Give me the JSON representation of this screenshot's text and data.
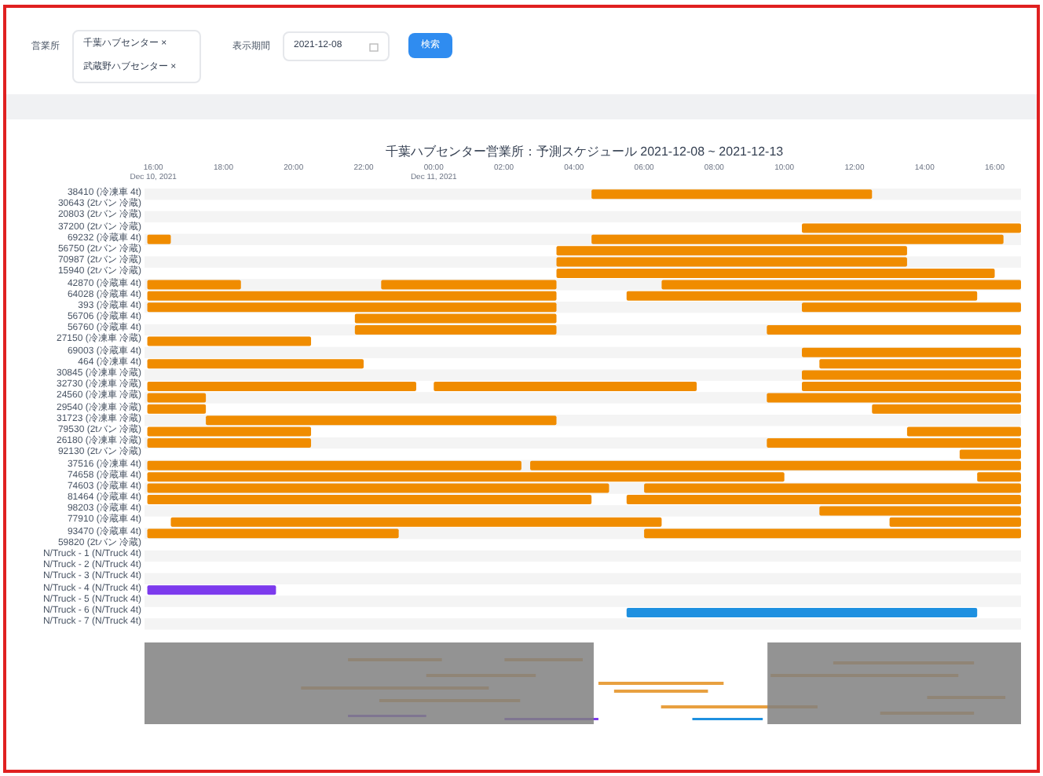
{
  "filters": {
    "office_label": "営業所",
    "offices": [
      {
        "label": "千葉ハブセンター ×"
      },
      {
        "label": "武蔵野ハブセンター ×"
      }
    ],
    "period_label": "表示期間",
    "date": "2021-12-08",
    "search_button": "検索"
  },
  "chart": {
    "title": "千葉ハブセンター営業所：予測スケジュール 2021-12-08 ~ 2021-12-13",
    "ticks": [
      {
        "label": "16:00",
        "date": "Dec 10, 2021"
      },
      {
        "label": "18:00"
      },
      {
        "label": "20:00"
      },
      {
        "label": "22:00"
      },
      {
        "label": "00:00",
        "date": "Dec 11, 2021"
      },
      {
        "label": "02:00"
      },
      {
        "label": "04:00"
      },
      {
        "label": "06:00"
      },
      {
        "label": "08:00"
      },
      {
        "label": "10:00"
      },
      {
        "label": "12:00"
      },
      {
        "label": "14:00"
      },
      {
        "label": "16:00"
      }
    ],
    "rows": [
      {
        "label": "38410 (冷凍車 4t)"
      },
      {
        "label": "30643 (2tバン 冷蔵)"
      },
      {
        "label": "20803 (2tバン 冷蔵)"
      },
      {
        "label": "37200 (2tバン 冷蔵)"
      },
      {
        "label": "69232 (冷蔵車 4t)"
      },
      {
        "label": "56750 (2tバン 冷蔵)"
      },
      {
        "label": "70987 (2tバン 冷蔵)"
      },
      {
        "label": "15940 (2tバン 冷蔵)"
      },
      {
        "label": "42870 (冷蔵車 4t)"
      },
      {
        "label": "64028 (冷蔵車 4t)"
      },
      {
        "label": "393 (冷蔵車 4t)"
      },
      {
        "label": "56706 (冷蔵車 4t)"
      },
      {
        "label": "56760 (冷蔵車 4t)"
      },
      {
        "label": "27150 (冷凍車 冷蔵)"
      },
      {
        "label": "69003 (冷蔵車 4t)"
      },
      {
        "label": "464 (冷凍車 4t)"
      },
      {
        "label": "30845 (冷凍車 冷蔵)"
      },
      {
        "label": "32730 (冷凍車 冷蔵)"
      },
      {
        "label": "24560 (冷凍車 冷蔵)"
      },
      {
        "label": "29540 (冷凍車 冷蔵)"
      },
      {
        "label": "31723 (冷凍車 冷蔵)"
      },
      {
        "label": "79530 (2tバン 冷蔵)"
      },
      {
        "label": "26180 (冷凍車 冷蔵)"
      },
      {
        "label": "92130 (2tバン 冷蔵)"
      },
      {
        "label": "37516 (冷凍車 4t)"
      },
      {
        "label": "74658 (冷蔵車 4t)"
      },
      {
        "label": "74603 (冷蔵車 4t)"
      },
      {
        "label": "81464 (冷蔵車 4t)"
      },
      {
        "label": "98203 (冷蔵車 4t)"
      },
      {
        "label": "77910 (冷蔵車 4t)"
      },
      {
        "label": "93470 (冷蔵車 4t)"
      },
      {
        "label": "59820 (2tバン 冷蔵)"
      },
      {
        "label": "N/Truck - 1 (N/Truck 4t)"
      },
      {
        "label": "N/Truck - 2 (N/Truck 4t)"
      },
      {
        "label": "N/Truck - 3 (N/Truck 4t)"
      },
      {
        "label": "N/Truck - 4 (N/Truck 4t)"
      },
      {
        "label": "N/Truck - 5 (N/Truck 4t)"
      },
      {
        "label": "N/Truck - 6 (N/Truck 4t)"
      },
      {
        "label": "N/Truck - 7 (N/Truck 4t)"
      }
    ]
  }
}
